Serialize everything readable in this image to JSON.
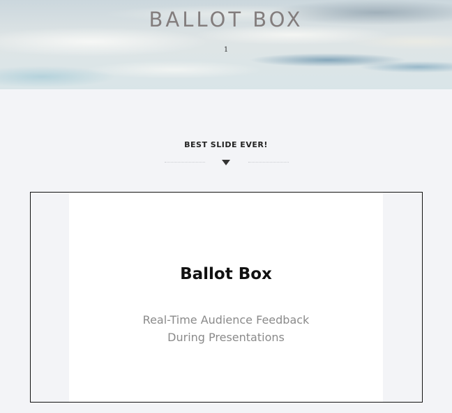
{
  "hero": {
    "title": "BALLOT BOX",
    "subtitle": "1"
  },
  "section": {
    "heading": "BEST SLIDE EVER!",
    "divider_icon": "caret-down-icon"
  },
  "slide": {
    "title": "Ballot Box",
    "subtitle_line1": "Real-Time Audience Feedback",
    "subtitle_line2": "During Presentations"
  },
  "colors": {
    "page_background": "#f3f4f7",
    "hero_title": "#837d7d",
    "slide_background": "#ffffff",
    "slide_subtitle": "#8a8a8a"
  }
}
